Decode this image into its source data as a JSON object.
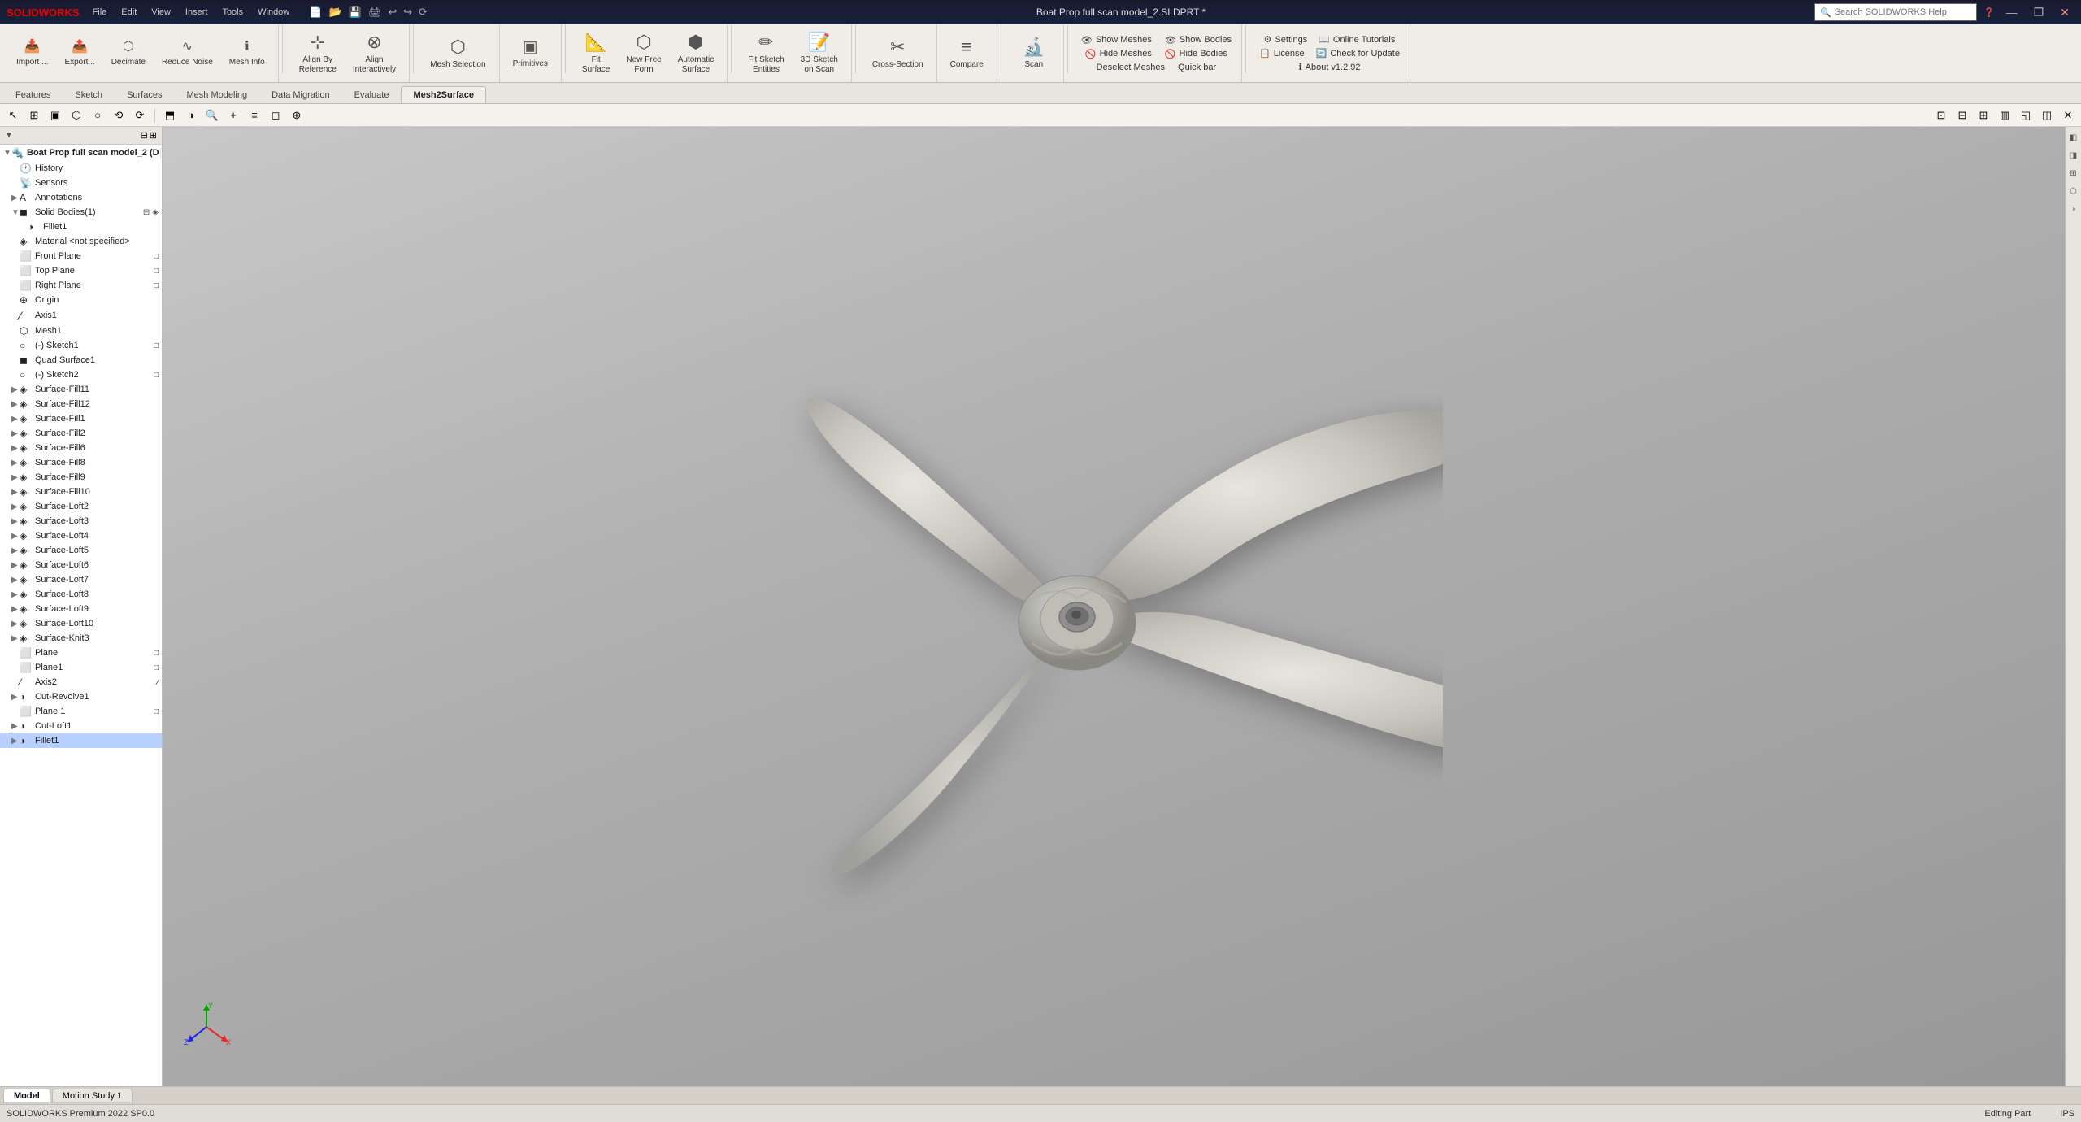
{
  "titlebar": {
    "logo": "SOLIDWORKS",
    "menus": [
      "File",
      "Edit",
      "View",
      "Insert",
      "Tools",
      "Window"
    ],
    "title": "Boat Prop full scan model_2.SLDPRT *",
    "search_placeholder": "Search SOLIDWORKS Help",
    "window_buttons": [
      "—",
      "❐",
      "✕"
    ]
  },
  "ribbon_tabs": [
    "Features",
    "Sketch",
    "Surfaces",
    "Mesh Modeling",
    "Data Migration",
    "Evaluate",
    "Mesh2Surface"
  ],
  "active_tab": "Mesh2Surface",
  "toolbar": {
    "groups": [
      {
        "name": "mesh-group",
        "items": [
          {
            "id": "decimate",
            "icon": "⬡",
            "label": "Decimate"
          },
          {
            "id": "export",
            "icon": "↑",
            "label": "Export..."
          },
          {
            "id": "reduce-noise",
            "icon": "∿",
            "label": "Reduce Noise"
          },
          {
            "id": "mesh-info",
            "icon": "ℹ",
            "label": "Mesh Info"
          }
        ]
      },
      {
        "name": "align-group",
        "items": [
          {
            "id": "align-by-reference",
            "icon": "⊹",
            "label": "Align By\nReference"
          },
          {
            "id": "align-interactively",
            "icon": "⊗",
            "label": "Align\nInteractively"
          }
        ]
      },
      {
        "name": "mesh-selection",
        "items": [
          {
            "id": "mesh-selection",
            "icon": "⬡",
            "label": "Mesh\nSelection"
          }
        ]
      },
      {
        "name": "primitives",
        "items": [
          {
            "id": "primitives",
            "icon": "◼",
            "label": "Primitives"
          }
        ]
      },
      {
        "name": "surface-group",
        "items": [
          {
            "id": "new-free-form",
            "icon": "⬡",
            "label": "New Free\nForm"
          },
          {
            "id": "automatic-surface",
            "icon": "⬡",
            "label": "Automatic\nSurface"
          }
        ]
      },
      {
        "name": "sketch-group",
        "items": [
          {
            "id": "fit-sketch",
            "icon": "✏",
            "label": "Fit Sketch\nEntities"
          },
          {
            "id": "3d-sketch-on-scan",
            "icon": "✏",
            "label": "3D Sketch\non Scan"
          }
        ]
      },
      {
        "name": "cross-section",
        "items": [
          {
            "id": "cross-section",
            "icon": "✂",
            "label": "Cross-Section"
          }
        ]
      },
      {
        "name": "compare",
        "items": [
          {
            "id": "compare",
            "icon": "≡",
            "label": "Compare"
          }
        ]
      },
      {
        "name": "scan",
        "items": [
          {
            "id": "scan",
            "icon": "⬡",
            "label": "Scan"
          }
        ]
      }
    ]
  },
  "show_hide_panel": {
    "show_meshes": "Show Meshes",
    "show_bodies": "Show Bodies",
    "hide_meshes": "Hide Meshes",
    "hide_bodies": "Hide Bodies",
    "deselect_meshes": "Deselect Meshes",
    "quick_bar": "Quick bar"
  },
  "settings_panel": {
    "settings": "Settings",
    "online_tutorials": "Online Tutorials",
    "license": "License",
    "check_update": "Check for Update",
    "about": "About v1.2.92"
  },
  "feature_tree": {
    "root": "Boat Prop full scan model_2 (D",
    "items": [
      {
        "id": "history",
        "icon": "🕐",
        "label": "History",
        "indent": 1
      },
      {
        "id": "sensors",
        "icon": "📡",
        "label": "Sensors",
        "indent": 1
      },
      {
        "id": "annotations",
        "icon": "A",
        "label": "Annotations",
        "indent": 1
      },
      {
        "id": "solid-bodies",
        "icon": "◼",
        "label": "Solid Bodies(1)",
        "indent": 1,
        "expanded": true
      },
      {
        "id": "fillet1",
        "icon": "◑",
        "label": "Fillet1",
        "indent": 2
      },
      {
        "id": "material",
        "icon": "◈",
        "label": "Material <not specified>",
        "indent": 1
      },
      {
        "id": "front-plane",
        "icon": "⬜",
        "label": "Front Plane",
        "indent": 1
      },
      {
        "id": "top-plane",
        "icon": "⬜",
        "label": "Top Plane",
        "indent": 1
      },
      {
        "id": "right-plane",
        "icon": "⬜",
        "label": "Right Plane",
        "indent": 1
      },
      {
        "id": "origin",
        "icon": "⊕",
        "label": "Origin",
        "indent": 1
      },
      {
        "id": "axis1",
        "icon": "⁄",
        "label": "Axis1",
        "indent": 1
      },
      {
        "id": "mesh1",
        "icon": "⬡",
        "label": "Mesh1",
        "indent": 1
      },
      {
        "id": "sketch1",
        "icon": "○",
        "label": "(-) Sketch1",
        "indent": 1
      },
      {
        "id": "quad-surface1",
        "icon": "◼",
        "label": "Quad Surface1",
        "indent": 1
      },
      {
        "id": "sketch2",
        "icon": "○",
        "label": "(-) Sketch2",
        "indent": 1
      },
      {
        "id": "surface-fill11",
        "icon": "◈",
        "label": "Surface-Fill11",
        "indent": 1
      },
      {
        "id": "surface-fill12",
        "icon": "◈",
        "label": "Surface-Fill12",
        "indent": 1
      },
      {
        "id": "surface-fill1",
        "icon": "◈",
        "label": "Surface-Fill1",
        "indent": 1
      },
      {
        "id": "surface-fill2",
        "icon": "◈",
        "label": "Surface-Fill2",
        "indent": 1
      },
      {
        "id": "surface-fill6",
        "icon": "◈",
        "label": "Surface-Fill6",
        "indent": 1
      },
      {
        "id": "surface-fill8",
        "icon": "◈",
        "label": "Surface-Fill8",
        "indent": 1
      },
      {
        "id": "surface-fill9",
        "icon": "◈",
        "label": "Surface-Fill9",
        "indent": 1
      },
      {
        "id": "surface-fill10",
        "icon": "◈",
        "label": "Surface-Fill10",
        "indent": 1
      },
      {
        "id": "surface-loft2",
        "icon": "◈",
        "label": "Surface-Loft2",
        "indent": 1
      },
      {
        "id": "surface-loft3",
        "icon": "◈",
        "label": "Surface-Loft3",
        "indent": 1
      },
      {
        "id": "surface-loft4",
        "icon": "◈",
        "label": "Surface-Loft4",
        "indent": 1
      },
      {
        "id": "surface-loft5",
        "icon": "◈",
        "label": "Surface-Loft5",
        "indent": 1
      },
      {
        "id": "surface-loft6",
        "icon": "◈",
        "label": "Surface-Loft6",
        "indent": 1
      },
      {
        "id": "surface-loft7",
        "icon": "◈",
        "label": "Surface-Loft7",
        "indent": 1
      },
      {
        "id": "surface-loft8",
        "icon": "◈",
        "label": "Surface-Loft8",
        "indent": 1
      },
      {
        "id": "surface-loft9",
        "icon": "◈",
        "label": "Surface-Loft9",
        "indent": 1
      },
      {
        "id": "surface-loft10",
        "icon": "◈",
        "label": "Surface-Loft10",
        "indent": 1
      },
      {
        "id": "surface-knit3",
        "icon": "◈",
        "label": "Surface-Knit3",
        "indent": 1
      },
      {
        "id": "plane",
        "icon": "⬜",
        "label": "Plane",
        "indent": 1
      },
      {
        "id": "plane1",
        "icon": "⬜",
        "label": "Plane1",
        "indent": 1
      },
      {
        "id": "axis2",
        "icon": "⁄",
        "label": "Axis2",
        "indent": 1
      },
      {
        "id": "cut-revolve1",
        "icon": "◑",
        "label": "Cut-Revolve1",
        "indent": 1
      },
      {
        "id": "plane-1",
        "icon": "⬜",
        "label": "Plane 1",
        "indent": 1
      },
      {
        "id": "cut-loft1",
        "icon": "◑",
        "label": "Cut-Loft1",
        "indent": 1
      },
      {
        "id": "fillet1-bottom",
        "icon": "◑",
        "label": "Fillet1",
        "indent": 1,
        "selected": true
      }
    ]
  },
  "bottom_tabs": [
    {
      "id": "model",
      "label": "Model",
      "active": true
    },
    {
      "id": "motion-study-1",
      "label": "Motion Study 1",
      "active": false
    }
  ],
  "statusbar": {
    "sw_version": "SOLIDWORKS Premium 2022 SP0.0",
    "editing": "Editing Part",
    "ips": "IPS"
  },
  "viewport": {
    "background_color": "#c0bdb8"
  },
  "secondary_toolbar": {
    "buttons": [
      "⊞",
      "▣",
      "⬡",
      "○",
      "⟲",
      "⟳",
      "⬒",
      "◑",
      "🔍",
      "+",
      "≡",
      "◻",
      "⊕"
    ]
  }
}
